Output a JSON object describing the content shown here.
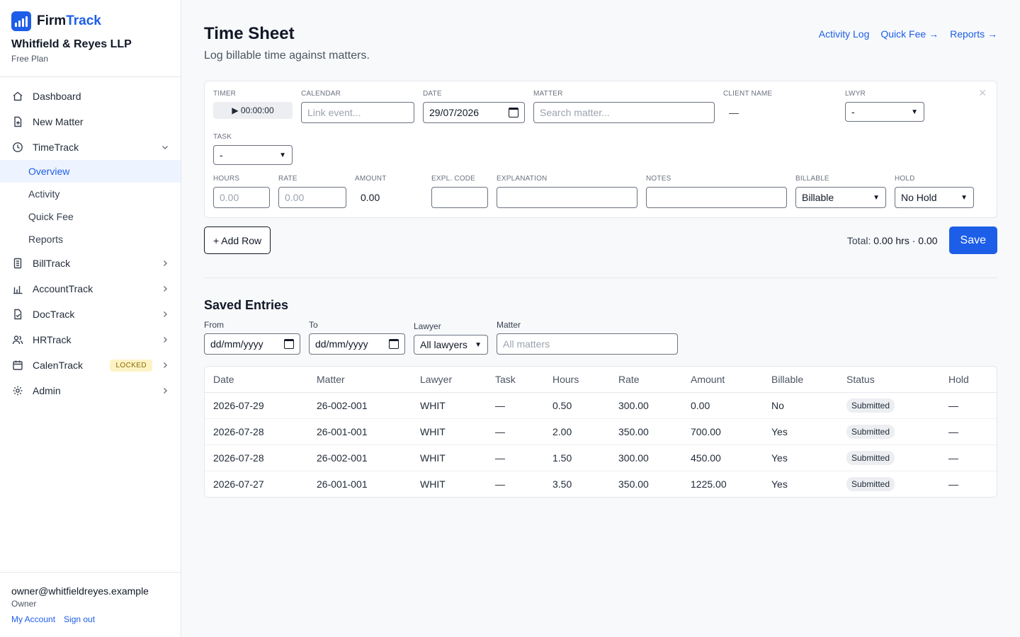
{
  "brand": {
    "name_part1": "Firm",
    "name_part2": "Track",
    "firm_name": "Whitfield & Reyes LLP",
    "plan": "Free Plan"
  },
  "nav": {
    "dashboard": "Dashboard",
    "new_matter": "New Matter",
    "timetrack": "TimeTrack",
    "sub": {
      "overview": "Overview",
      "activity": "Activity",
      "quick_fee": "Quick Fee",
      "reports": "Reports"
    },
    "billtrack": "BillTrack",
    "accounttrack": "AccountTrack",
    "doctrack": "DocTrack",
    "hrtrack": "HRTrack",
    "calentrack": "CalenTrack",
    "locked_badge": "LOCKED",
    "admin": "Admin"
  },
  "user": {
    "email": "owner@whitfieldreyes.example",
    "role": "Owner",
    "my_account": "My Account",
    "sign_out": "Sign out"
  },
  "header": {
    "title": "Time Sheet",
    "subtitle": "Log billable time against matters.",
    "link_activity": "Activity Log",
    "link_quick_fee": "Quick Fee →",
    "link_reports": "Reports →"
  },
  "entry": {
    "labels": {
      "timer": "TIMER",
      "calendar": "CALENDAR",
      "date": "DATE",
      "matter": "MATTER",
      "client": "CLIENT NAME",
      "lwyr": "LWYR",
      "task": "TASK",
      "hours": "HOURS",
      "rate": "RATE",
      "amount": "AMOUNT",
      "expl_code": "EXPL. CODE",
      "explanation": "EXPLANATION",
      "notes": "NOTES",
      "billable": "BILLABLE",
      "hold": "HOLD"
    },
    "timer_value": "▶ 00:00:00",
    "calendar_placeholder": "Link event...",
    "date_value": "29/07/2026",
    "matter_placeholder": "Search matter...",
    "client_value": "—",
    "lwyr_value": "-",
    "task_value": "-",
    "hours_placeholder": "0.00",
    "rate_placeholder": "0.00",
    "amount_value": "0.00",
    "billable_value": "Billable",
    "hold_value": "No Hold",
    "close": "✕"
  },
  "actions": {
    "add_row": "+ Add Row",
    "total_label": "Total:",
    "total_value": "0.00 hrs · 0.00",
    "save": "Save"
  },
  "saved": {
    "title": "Saved Entries",
    "filters": {
      "from_label": "From",
      "from_value": "dd/mm/yyyy",
      "to_label": "To",
      "to_value": "dd/mm/yyyy",
      "lawyer_label": "Lawyer",
      "lawyer_value": "All lawyers",
      "matter_label": "Matter",
      "matter_placeholder": "All matters"
    },
    "columns": [
      "Date",
      "Matter",
      "Lawyer",
      "Task",
      "Hours",
      "Rate",
      "Amount",
      "Billable",
      "Status",
      "Hold"
    ],
    "rows": [
      [
        "2026-07-29",
        "26-002-001",
        "WHIT",
        "—",
        "0.50",
        "300.00",
        "0.00",
        "No",
        "Submitted",
        "—"
      ],
      [
        "2026-07-28",
        "26-001-001",
        "WHIT",
        "—",
        "2.00",
        "350.00",
        "700.00",
        "Yes",
        "Submitted",
        "—"
      ],
      [
        "2026-07-28",
        "26-002-001",
        "WHIT",
        "—",
        "1.50",
        "300.00",
        "450.00",
        "Yes",
        "Submitted",
        "—"
      ],
      [
        "2026-07-27",
        "26-001-001",
        "WHIT",
        "—",
        "3.50",
        "350.00",
        "1225.00",
        "Yes",
        "Submitted",
        "—"
      ]
    ]
  }
}
